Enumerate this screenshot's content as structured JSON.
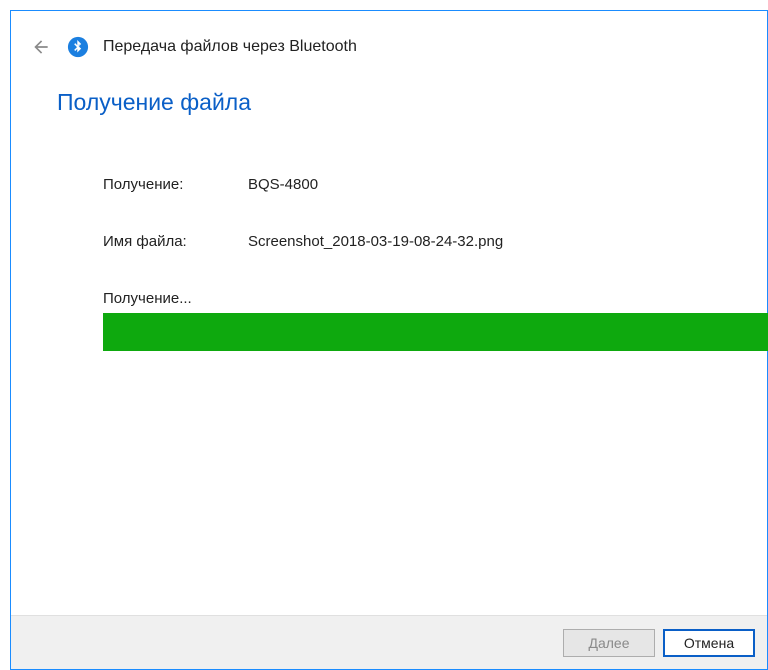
{
  "header": {
    "title": "Передача файлов через Bluetooth"
  },
  "page": {
    "heading": "Получение файла"
  },
  "fields": {
    "receiving_label": "Получение:",
    "receiving_value": "BQS-4800",
    "filename_label": "Имя файла:",
    "filename_value": "Screenshot_2018-03-19-08-24-32.png",
    "status_label": "Получение..."
  },
  "progress": {
    "percent": 100,
    "color": "#0ea90e"
  },
  "footer": {
    "next_label": "Далее",
    "cancel_label": "Отмена"
  }
}
